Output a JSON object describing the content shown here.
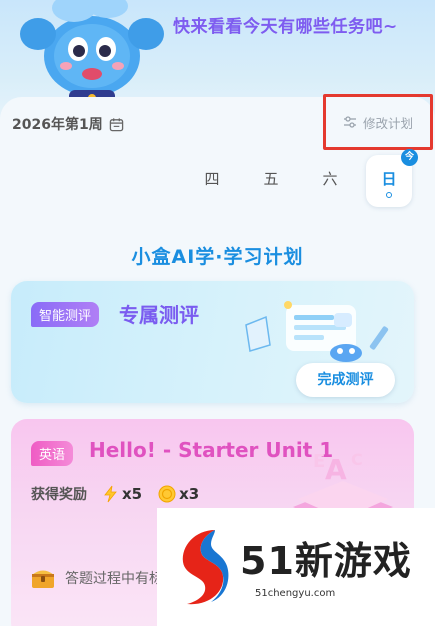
{
  "hero": {
    "message": "快来看看今天有哪些任务吧~"
  },
  "week": {
    "label": "2026年第1周",
    "edit_label": "修改计划"
  },
  "days": [
    {
      "label": "四",
      "today": false
    },
    {
      "label": "五",
      "today": false
    },
    {
      "label": "六",
      "today": false
    },
    {
      "label": "日",
      "today": true,
      "badge": "今"
    }
  ],
  "plan": {
    "title": "小盒AI学·学习计划"
  },
  "eval_card": {
    "tag": "智能测评",
    "title": "专属测评",
    "button": "完成测评"
  },
  "lesson_card": {
    "tag": "英语",
    "title": "Hello! - Starter Unit 1",
    "reward_label": "获得奖励",
    "rewards": [
      {
        "icon": "lightning-icon",
        "text": "x5"
      },
      {
        "icon": "coin-icon",
        "text": "x3"
      }
    ],
    "note": "答题过程中有标"
  },
  "watermark": {
    "brand": "51新游戏",
    "url": "51chengyu.com"
  },
  "colors": {
    "accent_blue": "#1a8ee0",
    "accent_purple": "#7a5cf0",
    "accent_pink": "#e052c0",
    "highlight_red": "#e4392f"
  }
}
